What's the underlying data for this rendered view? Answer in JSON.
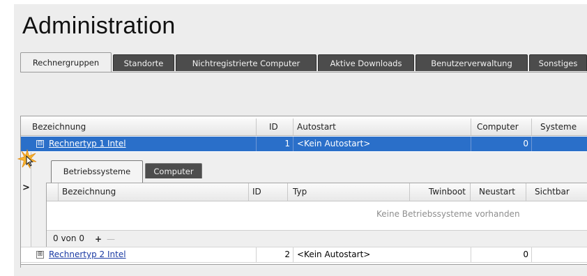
{
  "page": {
    "title": "Administration"
  },
  "tabs": [
    {
      "label": "Rechnergruppen",
      "active": true
    },
    {
      "label": "Standorte"
    },
    {
      "label": "Nichtregistrierte Computer"
    },
    {
      "label": "Aktive Downloads"
    },
    {
      "label": "Benutzerverwaltung"
    },
    {
      "label": "Sonstiges"
    }
  ],
  "grid": {
    "columns": [
      "Bezeichnung",
      "ID",
      "Autostart",
      "Computer",
      "Systeme"
    ],
    "rows": [
      {
        "name": "Rechnertyp 1 Intel",
        "id": "1",
        "autostart": "<Kein Autostart>",
        "computer": "0",
        "expander": "⊟",
        "selected": true
      },
      {
        "name": "Rechnertyp 2 Intel",
        "id": "2",
        "autostart": "<Kein Autostart>",
        "computer": "0",
        "expander": "⊞"
      }
    ],
    "row_indicator": ">"
  },
  "detail": {
    "tabs": [
      {
        "label": "Betriebssysteme",
        "active": true
      },
      {
        "label": "Computer"
      }
    ],
    "columns": [
      "Bezeichnung",
      "ID",
      "Typ",
      "Twinboot",
      "Neustart",
      "Sichtbar"
    ],
    "empty_message": "Keine Betriebssysteme vorhanden",
    "pager": {
      "text": "0 von 0",
      "add_symbol": "+",
      "remove_symbol": "—"
    }
  },
  "colors": {
    "selected_row": "#2a6fc9",
    "inactive_tab": "#4c4c4c",
    "link": "#1a3aa3"
  },
  "icons": {
    "expand": "plus-box",
    "collapse": "minus-box",
    "cursor_highlight": "starburst"
  }
}
